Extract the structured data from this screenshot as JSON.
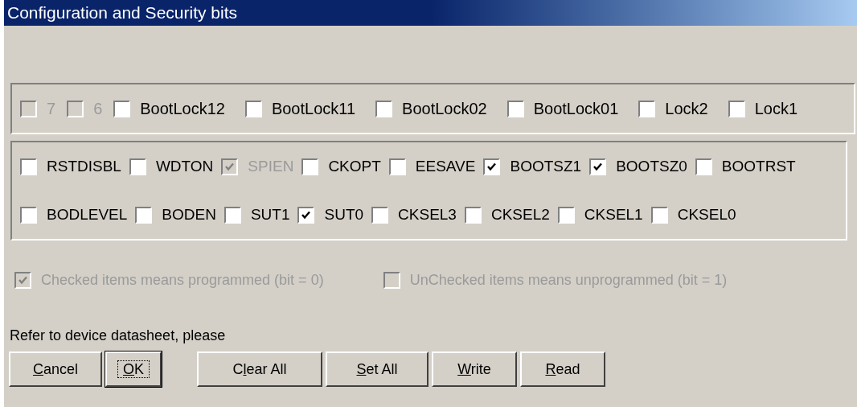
{
  "window": {
    "title": "Configuration and Security bits"
  },
  "lock_bits": [
    {
      "label": "7",
      "checked": false,
      "disabled": true
    },
    {
      "label": "6",
      "checked": false,
      "disabled": true
    },
    {
      "label": "BootLock12",
      "checked": false,
      "disabled": false
    },
    {
      "label": "BootLock11",
      "checked": false,
      "disabled": false
    },
    {
      "label": "BootLock02",
      "checked": false,
      "disabled": false
    },
    {
      "label": "BootLock01",
      "checked": false,
      "disabled": false
    },
    {
      "label": "Lock2",
      "checked": false,
      "disabled": false
    },
    {
      "label": "Lock1",
      "checked": false,
      "disabled": false
    }
  ],
  "fuse_rows": [
    [
      {
        "label": "RSTDISBL",
        "checked": false,
        "disabled": false
      },
      {
        "label": "WDTON",
        "checked": false,
        "disabled": false
      },
      {
        "label": "SPIEN",
        "checked": true,
        "disabled": true
      },
      {
        "label": "CKOPT",
        "checked": false,
        "disabled": false
      },
      {
        "label": "EESAVE",
        "checked": false,
        "disabled": false
      },
      {
        "label": "BOOTSZ1",
        "checked": true,
        "disabled": false
      },
      {
        "label": "BOOTSZ0",
        "checked": true,
        "disabled": false
      },
      {
        "label": "BOOTRST",
        "checked": false,
        "disabled": false
      }
    ],
    [
      {
        "label": "BODLEVEL",
        "checked": false,
        "disabled": false
      },
      {
        "label": "BODEN",
        "checked": false,
        "disabled": false
      },
      {
        "label": "SUT1",
        "checked": false,
        "disabled": false
      },
      {
        "label": "SUT0",
        "checked": true,
        "disabled": false
      },
      {
        "label": "CKSEL3",
        "checked": false,
        "disabled": false
      },
      {
        "label": "CKSEL2",
        "checked": false,
        "disabled": false
      },
      {
        "label": "CKSEL1",
        "checked": false,
        "disabled": false
      },
      {
        "label": "CKSEL0",
        "checked": false,
        "disabled": false
      }
    ]
  ],
  "legend": [
    {
      "label": "Checked items means programmed (bit = 0)",
      "checked": true,
      "disabled": true
    },
    {
      "label": "UnChecked items means unprogrammed (bit = 1)",
      "checked": false,
      "disabled": true
    }
  ],
  "note": "Refer to device datasheet, please",
  "buttons": [
    {
      "access_key": "C",
      "rest": "ancel",
      "default": false
    },
    {
      "access_key": "O",
      "rest": "K",
      "default": true
    },
    {
      "lead": "C",
      "access_key": "l",
      "rest": "ear All",
      "default": false
    },
    {
      "access_key": "S",
      "rest": "et All",
      "default": false
    },
    {
      "access_key": "W",
      "rest": "rite",
      "default": false
    },
    {
      "access_key": "R",
      "rest": "ead",
      "default": false
    }
  ]
}
